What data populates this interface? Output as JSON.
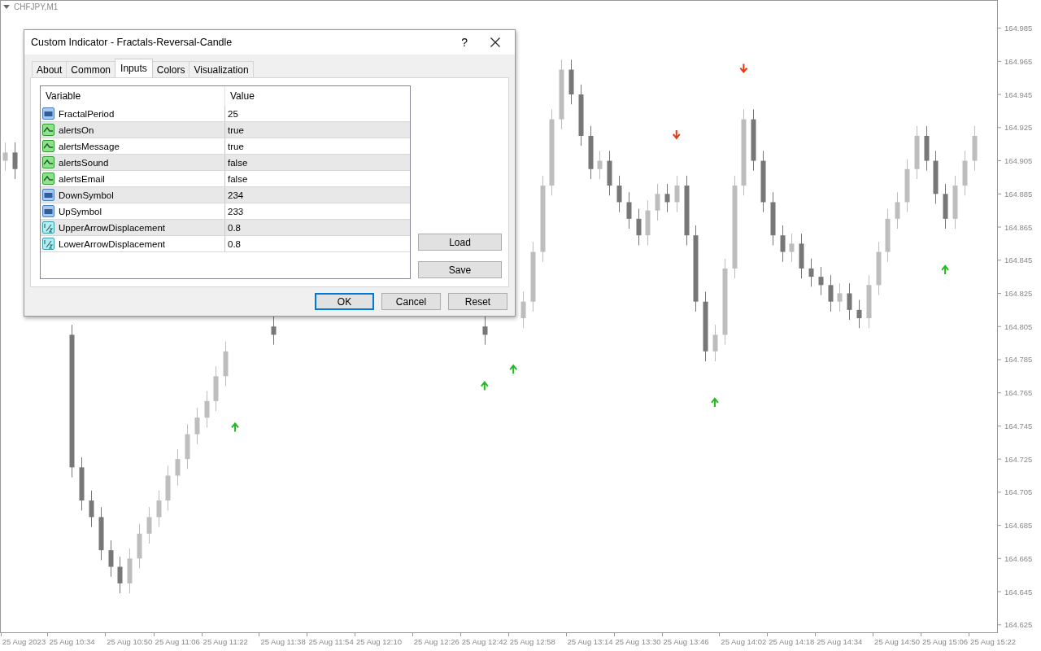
{
  "chart": {
    "chart_data": {
      "type": "candlestick",
      "title": "CHFJPY,M1",
      "categories": [
        null,
        null,
        "25 Aug 2023",
        null,
        null,
        null,
        null,
        "25 Aug 10:34",
        null,
        null,
        null,
        null,
        null,
        "25 Aug 10:50",
        null,
        null,
        null,
        null,
        "25 Aug 11:06",
        null,
        null,
        null,
        null,
        "25 Aug 11:22",
        null,
        null,
        null,
        null,
        null,
        "25 Aug 11:38",
        null,
        null,
        null,
        null,
        "25 Aug 11:54",
        null,
        null,
        null,
        null,
        "25 Aug 12:10",
        null,
        null,
        null,
        null,
        null,
        "25 Aug 12:26",
        null,
        null,
        null,
        null,
        "25 Aug 12:42",
        null,
        null,
        null,
        null,
        "25 Aug 12:58",
        null,
        null,
        null,
        null,
        null,
        "25 Aug 13:14",
        null,
        null,
        null,
        null,
        "25 Aug 13:30",
        null,
        null,
        null,
        null,
        "25 Aug 13:46",
        null,
        null,
        null,
        null,
        null,
        "25 Aug 14:02",
        null,
        null,
        null,
        null,
        "25 Aug 14:18",
        null,
        null,
        null,
        null,
        "25 Aug 14:34",
        null,
        null,
        null,
        null,
        null,
        "25 Aug 14:50",
        null,
        null,
        null,
        null,
        "25 Aug 15:06",
        null,
        null,
        null,
        null,
        "25 Aug 15:22"
      ],
      "ohlc": [
        [
          164.905,
          164.916,
          164.899,
          164.91
        ],
        [
          164.91,
          164.916,
          164.894,
          164.9
        ],
        null,
        null,
        null,
        null,
        null,
        [
          164.8,
          164.806,
          164.714,
          164.72
        ],
        [
          164.72,
          164.726,
          164.694,
          164.7
        ],
        [
          164.7,
          164.706,
          164.684,
          164.69
        ],
        [
          164.69,
          164.696,
          164.664,
          164.67
        ],
        [
          164.67,
          164.676,
          164.654,
          164.66
        ],
        [
          164.66,
          164.666,
          164.644,
          164.65
        ],
        [
          164.65,
          164.671,
          164.644,
          164.665
        ],
        [
          164.665,
          164.686,
          164.659,
          164.68
        ],
        [
          164.68,
          164.696,
          164.674,
          164.69
        ],
        [
          164.69,
          164.706,
          164.684,
          164.7
        ],
        [
          164.7,
          164.721,
          164.694,
          164.715
        ],
        [
          164.715,
          164.731,
          164.709,
          164.725
        ],
        [
          164.725,
          164.746,
          164.719,
          164.74
        ],
        [
          164.74,
          164.756,
          164.734,
          164.75
        ],
        [
          164.75,
          164.766,
          164.744,
          164.76
        ],
        [
          164.76,
          164.781,
          164.754,
          164.775
        ],
        [
          164.775,
          164.796,
          164.769,
          164.79
        ],
        null,
        null,
        null,
        null,
        [
          164.805,
          164.811,
          164.794,
          164.8
        ],
        null,
        null,
        null,
        null,
        null,
        null,
        null,
        null,
        null,
        null,
        null,
        null,
        null,
        null,
        null,
        null,
        null,
        null,
        null,
        null,
        null,
        [
          164.805,
          164.811,
          164.794,
          164.8
        ],
        null,
        null,
        null,
        [
          164.81,
          164.826,
          164.804,
          164.82
        ],
        [
          164.82,
          164.856,
          164.814,
          164.85
        ],
        [
          164.85,
          164.896,
          164.844,
          164.89
        ],
        [
          164.89,
          164.936,
          164.884,
          164.93
        ],
        [
          164.93,
          164.966,
          164.924,
          164.96
        ],
        [
          164.96,
          164.966,
          164.939,
          164.945
        ],
        [
          164.945,
          164.951,
          164.914,
          164.92
        ],
        [
          164.92,
          164.926,
          164.894,
          164.9
        ],
        [
          164.9,
          164.911,
          164.894,
          164.905
        ],
        [
          164.905,
          164.911,
          164.884,
          164.89
        ],
        [
          164.89,
          164.896,
          164.874,
          164.88
        ],
        [
          164.88,
          164.886,
          164.864,
          164.87
        ],
        [
          164.87,
          164.876,
          164.854,
          164.86
        ],
        [
          164.86,
          164.881,
          164.854,
          164.875
        ],
        [
          164.875,
          164.891,
          164.869,
          164.885
        ],
        [
          164.885,
          164.891,
          164.874,
          164.88
        ],
        [
          164.88,
          164.896,
          164.874,
          164.89
        ],
        [
          164.89,
          164.896,
          164.854,
          164.86
        ],
        [
          164.86,
          164.866,
          164.814,
          164.82
        ],
        [
          164.82,
          164.826,
          164.784,
          164.79
        ],
        [
          164.79,
          164.806,
          164.784,
          164.8
        ],
        [
          164.8,
          164.846,
          164.794,
          164.84
        ],
        [
          164.84,
          164.896,
          164.834,
          164.89
        ],
        [
          164.89,
          164.936,
          164.884,
          164.93
        ],
        [
          164.93,
          164.936,
          164.899,
          164.905
        ],
        [
          164.905,
          164.911,
          164.874,
          164.88
        ],
        [
          164.88,
          164.886,
          164.854,
          164.86
        ],
        [
          164.86,
          164.866,
          164.844,
          164.85
        ],
        [
          164.85,
          164.861,
          164.844,
          164.855
        ],
        [
          164.855,
          164.861,
          164.834,
          164.84
        ],
        [
          164.84,
          164.846,
          164.829,
          164.835
        ],
        [
          164.835,
          164.841,
          164.824,
          164.83
        ],
        [
          164.83,
          164.836,
          164.814,
          164.82
        ],
        [
          164.82,
          164.831,
          164.814,
          164.825
        ],
        [
          164.825,
          164.831,
          164.809,
          164.815
        ],
        [
          164.815,
          164.821,
          164.804,
          164.81
        ],
        [
          164.81,
          164.836,
          164.804,
          164.83
        ],
        [
          164.83,
          164.856,
          164.824,
          164.85
        ],
        [
          164.85,
          164.876,
          164.844,
          164.87
        ],
        [
          164.87,
          164.886,
          164.864,
          164.88
        ],
        [
          164.88,
          164.906,
          164.874,
          164.9
        ],
        [
          164.9,
          164.926,
          164.894,
          164.92
        ],
        [
          164.92,
          164.926,
          164.899,
          164.905
        ],
        [
          164.905,
          164.911,
          164.879,
          164.885
        ],
        [
          164.885,
          164.891,
          164.864,
          164.87
        ],
        [
          164.87,
          164.896,
          164.864,
          164.89
        ],
        [
          164.89,
          164.911,
          164.884,
          164.905
        ],
        [
          164.905,
          164.926,
          164.899,
          164.92
        ],
        null,
        null
      ],
      "ylim": [
        164.62,
        165.002
      ],
      "yticks": [
        {
          "value": 164.985,
          "label": "164.985"
        },
        {
          "value": 164.965,
          "label": "164.965"
        },
        {
          "value": 164.945,
          "label": "164.945"
        },
        {
          "value": 164.925,
          "label": "164.925"
        },
        {
          "value": 164.905,
          "label": "164.905"
        },
        {
          "value": 164.885,
          "label": "164.885"
        },
        {
          "value": 164.865,
          "label": "164.865"
        },
        {
          "value": 164.845,
          "label": "164.845"
        },
        {
          "value": 164.825,
          "label": "164.825"
        },
        {
          "value": 164.805,
          "label": "164.805"
        },
        {
          "value": 164.785,
          "label": "164.785"
        },
        {
          "value": 164.765,
          "label": "164.765"
        },
        {
          "value": 164.745,
          "label": "164.745"
        },
        {
          "value": 164.725,
          "label": "164.725"
        },
        {
          "value": 164.705,
          "label": "164.705"
        },
        {
          "value": 164.685,
          "label": "164.685"
        },
        {
          "value": 164.665,
          "label": "164.665"
        },
        {
          "value": 164.645,
          "label": "164.645"
        },
        {
          "value": 164.625,
          "label": "164.625"
        }
      ]
    },
    "fractal_arrows": [
      null,
      null,
      null,
      null,
      null,
      null,
      null,
      null,
      null,
      null,
      null,
      null,
      null,
      null,
      null,
      null,
      null,
      null,
      null,
      null,
      null,
      null,
      null,
      null,
      {
        "kind": "up"
      },
      null,
      null,
      null,
      null,
      null,
      null,
      null,
      null,
      null,
      null,
      null,
      null,
      null,
      null,
      null,
      null,
      null,
      null,
      null,
      null,
      null,
      null,
      null,
      null,
      null,
      {
        "kind": "up"
      },
      null,
      null,
      {
        "kind": "up"
      },
      null,
      null,
      null,
      null,
      null,
      null,
      null,
      null,
      null,
      null,
      null,
      null,
      null,
      null,
      null,
      null,
      {
        "kind": "down"
      },
      null,
      null,
      null,
      {
        "kind": "up"
      },
      null,
      null,
      {
        "kind": "down"
      },
      null,
      null,
      null,
      null,
      null,
      null,
      null,
      null,
      null,
      null,
      null,
      null,
      null,
      null,
      null,
      null,
      null,
      null,
      null,
      null,
      {
        "kind": "up"
      },
      null,
      null,
      null,
      null,
      null
    ]
  },
  "dialog": {
    "title": "Custom Indicator - Fractals-Reversal-Candle",
    "help": "?",
    "tabs": [
      {
        "label": "About",
        "selected": false
      },
      {
        "label": "Common",
        "selected": false
      },
      {
        "label": "Inputs",
        "selected": true
      },
      {
        "label": "Colors",
        "selected": false
      },
      {
        "label": "Visualization",
        "selected": false
      }
    ],
    "table": {
      "columns": [
        "Variable",
        "Value"
      ],
      "rows": [
        {
          "kind": "int",
          "variable": "FractalPeriod",
          "value": "25"
        },
        {
          "kind": "bool",
          "variable": "alertsOn",
          "value": "true"
        },
        {
          "kind": "bool",
          "variable": "alertsMessage",
          "value": "true"
        },
        {
          "kind": "bool",
          "variable": "alertsSound",
          "value": "false"
        },
        {
          "kind": "bool",
          "variable": "alertsEmail",
          "value": "false"
        },
        {
          "kind": "int",
          "variable": "DownSymbol",
          "value": "234"
        },
        {
          "kind": "int",
          "variable": "UpSymbol",
          "value": "233"
        },
        {
          "kind": "double",
          "variable": "UpperArrowDisplacement",
          "value": "0.8"
        },
        {
          "kind": "double",
          "variable": "LowerArrowDisplacement",
          "value": "0.8"
        }
      ]
    },
    "side_buttons": [
      "Load",
      "Save"
    ],
    "buttons": [
      {
        "label": "OK",
        "default": true
      },
      {
        "label": "Cancel",
        "default": false
      },
      {
        "label": "Reset",
        "default": false
      }
    ]
  }
}
